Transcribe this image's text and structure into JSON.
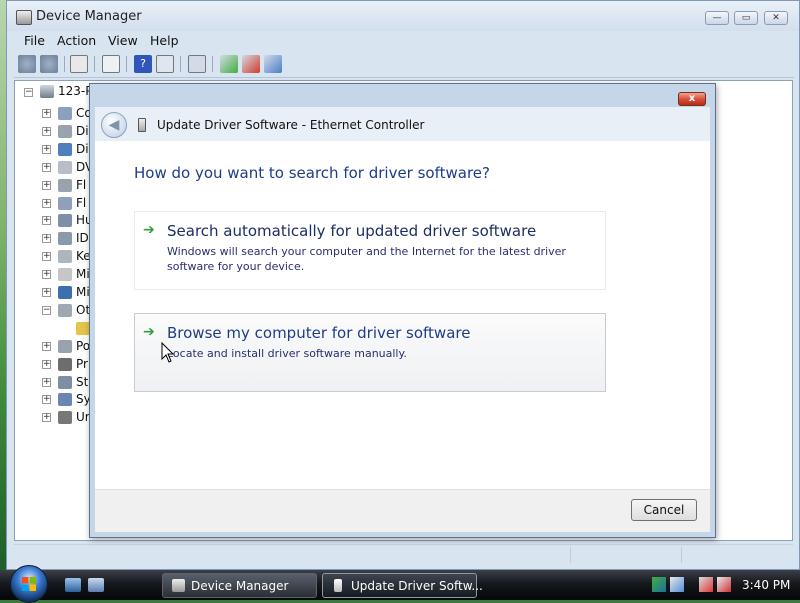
{
  "device_manager": {
    "title": "Device Manager",
    "menu": [
      "File",
      "Action",
      "View",
      "Help"
    ],
    "toolbar_icons": [
      "back-icon",
      "forward-icon",
      "properties-icon",
      "refresh-icon",
      "help-icon",
      "details-icon",
      "scan-hardware-icon",
      "update-driver-icon",
      "disable-icon",
      "uninstall-icon"
    ],
    "tree": {
      "root": "123-P",
      "items": [
        {
          "label": "Co",
          "expander": "+",
          "icon": "computer-icon"
        },
        {
          "label": "Di",
          "expander": "+",
          "icon": "disk-drive-icon"
        },
        {
          "label": "Di",
          "expander": "+",
          "icon": "display-adapter-icon"
        },
        {
          "label": "DV",
          "expander": "+",
          "icon": "dvd-drive-icon"
        },
        {
          "label": "Fl",
          "expander": "+",
          "icon": "floppy-controller-icon"
        },
        {
          "label": "Fl",
          "expander": "+",
          "icon": "floppy-drive-icon"
        },
        {
          "label": "Hu",
          "expander": "+",
          "icon": "hid-icon"
        },
        {
          "label": "ID",
          "expander": "+",
          "icon": "ide-controller-icon"
        },
        {
          "label": "Ke",
          "expander": "+",
          "icon": "keyboard-icon"
        },
        {
          "label": "Mi",
          "expander": "+",
          "icon": "mouse-icon"
        },
        {
          "label": "Mi",
          "expander": "+",
          "icon": "monitor-icon"
        },
        {
          "label": "Ot",
          "expander": "−",
          "icon": "other-devices-icon"
        },
        {
          "label": "",
          "expander": "",
          "icon": "warning-icon"
        },
        {
          "label": "Po",
          "expander": "+",
          "icon": "ports-icon"
        },
        {
          "label": "Pr",
          "expander": "+",
          "icon": "processor-icon"
        },
        {
          "label": "St",
          "expander": "+",
          "icon": "storage-icon"
        },
        {
          "label": "Sy",
          "expander": "+",
          "icon": "system-devices-icon"
        },
        {
          "label": "Ur",
          "expander": "+",
          "icon": "usb-icon"
        }
      ]
    }
  },
  "dialog": {
    "title": "Update Driver Software - Ethernet Controller",
    "close_label": "x",
    "heading": "How do you want to search for driver software?",
    "options": [
      {
        "title": "Search automatically for updated driver software",
        "description": "Windows will search your computer and the Internet for the latest driver software for your device."
      },
      {
        "title": "Browse my computer for driver software",
        "description": "Locate and install driver software manually."
      }
    ],
    "cancel_label": "Cancel"
  },
  "taskbar": {
    "buttons": [
      {
        "label": "Device Manager"
      },
      {
        "label": "Update Driver Softw..."
      }
    ],
    "clock": "3:40 PM"
  },
  "colors": {
    "heading_blue": "#1e3c88",
    "arrow_green": "#2f9d3a",
    "close_red": "#c8401f"
  }
}
